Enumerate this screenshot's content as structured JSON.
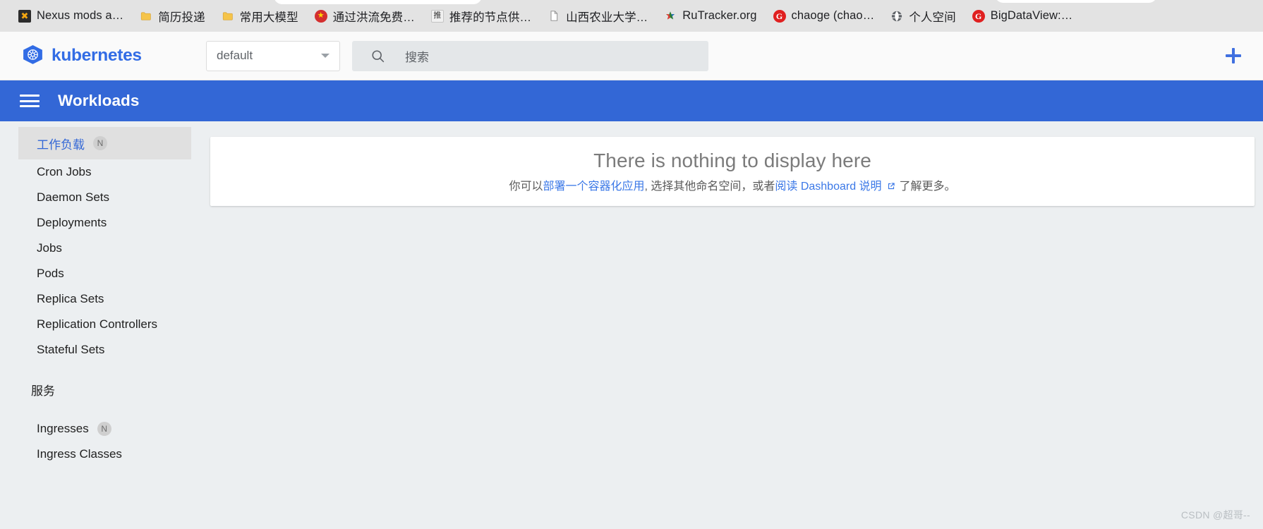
{
  "browser": {
    "bookmarks": [
      {
        "label": "Nexus mods a…",
        "icon": "nexus-icon",
        "glyph": "✖"
      },
      {
        "label": "简历投递",
        "icon": "folder-icon",
        "glyph": ""
      },
      {
        "label": "常用大模型",
        "icon": "folder-icon",
        "glyph": ""
      },
      {
        "label": "通过洪流免费…",
        "icon": "china-emblem-icon",
        "glyph": "★"
      },
      {
        "label": "推荐的节点供…",
        "icon": "tui-icon",
        "glyph": "推"
      },
      {
        "label": "山西农业大学…",
        "icon": "document-icon",
        "glyph": ""
      },
      {
        "label": "RuTracker.org",
        "icon": "rutracker-icon",
        "glyph": "✿"
      },
      {
        "label": "chaoge (chao…",
        "icon": "gitee-icon",
        "glyph": "G"
      },
      {
        "label": "个人空间",
        "icon": "globe-icon",
        "glyph": ""
      },
      {
        "label": "BigDataView:…",
        "icon": "gitee-icon",
        "glyph": "G"
      }
    ]
  },
  "header": {
    "brand": "kubernetes",
    "logo_icon": "kubernetes-helm-icon",
    "namespace": {
      "selected": "default",
      "caret_icon": "chevron-down-icon"
    },
    "search": {
      "placeholder": "搜索",
      "icon": "search-icon"
    },
    "create_button": {
      "icon": "plus-icon",
      "label": "+"
    }
  },
  "toolbar": {
    "menu_icon": "hamburger-menu-icon",
    "title": "Workloads"
  },
  "sidebar": {
    "groups": [
      {
        "header": {
          "label": "工作负载",
          "badge": "N",
          "active": true
        },
        "items": [
          {
            "label": "Cron Jobs",
            "badge": null
          },
          {
            "label": "Daemon Sets",
            "badge": null
          },
          {
            "label": "Deployments",
            "badge": null
          },
          {
            "label": "Jobs",
            "badge": null
          },
          {
            "label": "Pods",
            "badge": null
          },
          {
            "label": "Replica Sets",
            "badge": null
          },
          {
            "label": "Replication Controllers",
            "badge": null
          },
          {
            "label": "Stateful Sets",
            "badge": null
          }
        ]
      },
      {
        "header": {
          "label": "服务",
          "badge": null,
          "active": false
        },
        "items": [
          {
            "label": "Ingresses",
            "badge": "N"
          },
          {
            "label": "Ingress Classes",
            "badge": null
          }
        ]
      }
    ]
  },
  "main": {
    "empty_state": {
      "title": "There is nothing to display here",
      "sub_prefix": "你可以 ",
      "link_deploy": "部署一个容器化应用",
      "sub_middle": ", 选择其他命名空间，或者 ",
      "link_docs": "阅读 Dashboard 说明",
      "external_icon": "external-link-icon",
      "sub_suffix": "了解更多。"
    }
  },
  "watermark": "CSDN @超哥--",
  "colors": {
    "brand_blue": "#326ce5",
    "toolbar_blue": "#3367d6",
    "link_blue": "#3b78e7",
    "sidebar_bg": "#eceff1",
    "bookmark_bar_bg": "#e3e3e3"
  }
}
